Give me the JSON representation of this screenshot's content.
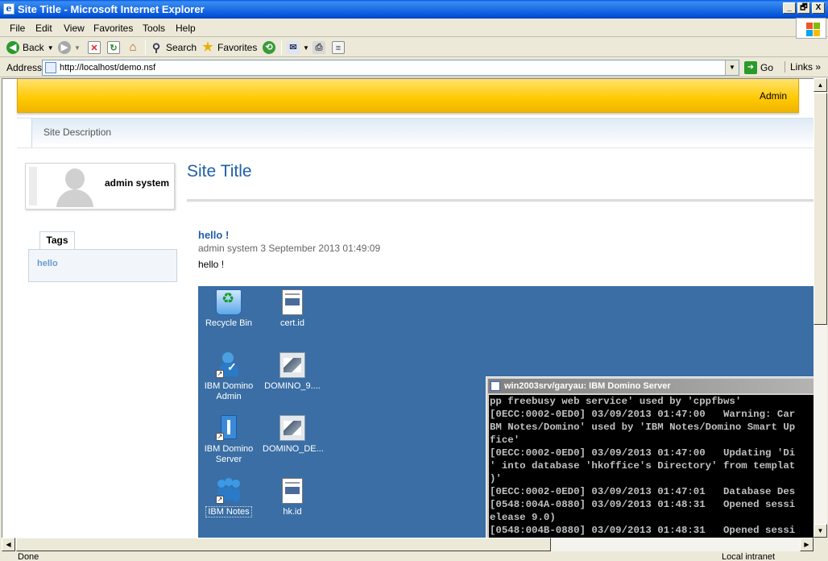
{
  "window": {
    "title": "Site Title - Microsoft Internet Explorer",
    "min": "_",
    "max": "🗗",
    "close": "X"
  },
  "menu": [
    "File",
    "Edit",
    "View",
    "Favorites",
    "Tools",
    "Help"
  ],
  "toolbar": {
    "back": "Back",
    "search": "Search",
    "favorites": "Favorites"
  },
  "address": {
    "label": "Address",
    "url": "http://localhost/demo.nsf",
    "go": "Go",
    "links": "Links"
  },
  "status": {
    "text": "Done",
    "zone": "Local intranet"
  },
  "page": {
    "admin_link": "Admin",
    "site_description": "Site Description",
    "user_name": "admin system",
    "tags_label": "Tags",
    "tag": "hello",
    "site_title": "Site Title",
    "post": {
      "title": "hello !",
      "meta": "admin system  3 September 2013 01:49:09",
      "body": "hello !"
    }
  },
  "screenshot": {
    "icons": [
      {
        "name": "recycle-bin",
        "label": "Recycle Bin"
      },
      {
        "name": "cert-id",
        "label": "cert.id"
      },
      {
        "name": "ibm-domino-admin",
        "label": "IBM Domino Admin"
      },
      {
        "name": "domino-9",
        "label": "DOMINO_9...."
      },
      {
        "name": "ibm-domino-server",
        "label": "IBM Domino Server"
      },
      {
        "name": "domino-de",
        "label": "DOMINO_DE..."
      },
      {
        "name": "ibm-notes",
        "label": "IBM Notes"
      },
      {
        "name": "hk-id",
        "label": "hk.id"
      }
    ],
    "console_title": "win2003srv/garyau: IBM Domino Server",
    "console_lines": [
      "pp freebusy web service' used by 'cppfbws'",
      "[0ECC:0002-0ED0] 03/09/2013 01:47:00   Warning: Car",
      "BM Notes/Domino' used by 'IBM Notes/Domino Smart Up",
      "fice'",
      "[0ECC:0002-0ED0] 03/09/2013 01:47:00   Updating 'Di",
      "' into database 'hkoffice's Directory' from templat",
      ")'",
      "[0ECC:0002-0ED0] 03/09/2013 01:47:01   Database Des",
      "[0548:004A-0880] 03/09/2013 01:48:31   Opened sessi",
      "elease 9.0)",
      "[0548:004B-0880] 03/09/2013 01:48:31   Opened sessi"
    ]
  }
}
